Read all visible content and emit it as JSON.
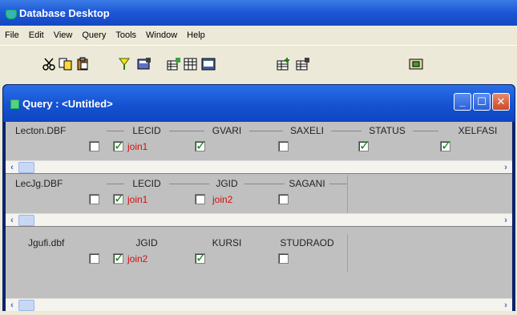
{
  "app": {
    "title": "Database Desktop"
  },
  "menu": [
    "File",
    "Edit",
    "View",
    "Query",
    "Tools",
    "Window",
    "Help"
  ],
  "toolbar": {
    "groups": [
      [
        "cut-icon",
        "copy-icon",
        "paste-icon"
      ],
      [
        "run-query-icon",
        "query-properties-icon"
      ],
      [
        "field-view-icon",
        "table-structure-icon",
        "sql-icon"
      ],
      [
        "add-table-icon",
        "remove-table-icon"
      ],
      [
        "answer-table-icon"
      ]
    ]
  },
  "query_window": {
    "title": "Query : <Untitled>",
    "tables": [
      {
        "name": "Lecton.DBF",
        "fields": [
          {
            "name": "LECID",
            "checked": true,
            "join": "join1"
          },
          {
            "name": "GVARI",
            "checked": true,
            "join": ""
          },
          {
            "name": "SAXELI",
            "checked": false,
            "join": ""
          },
          {
            "name": "STATUS",
            "checked": true,
            "join": ""
          },
          {
            "name": "XELFASI",
            "checked": true,
            "join": ""
          }
        ]
      },
      {
        "name": "LecJg.DBF",
        "fields": [
          {
            "name": "LECID",
            "checked": true,
            "join": "join1"
          },
          {
            "name": "JGID",
            "checked": false,
            "join": "join2"
          },
          {
            "name": "SAGANI",
            "checked": false,
            "join": ""
          }
        ]
      },
      {
        "name": "Jgufi.dbf",
        "fields": [
          {
            "name": "JGID",
            "checked": true,
            "join": "join2"
          },
          {
            "name": "KURSI",
            "checked": true,
            "join": ""
          },
          {
            "name": "STUDRAOD",
            "checked": false,
            "join": ""
          }
        ]
      }
    ]
  },
  "colors": {
    "titlebar": "#1c56d6",
    "join_text": "#d01010",
    "check": "#1a8a1a"
  }
}
